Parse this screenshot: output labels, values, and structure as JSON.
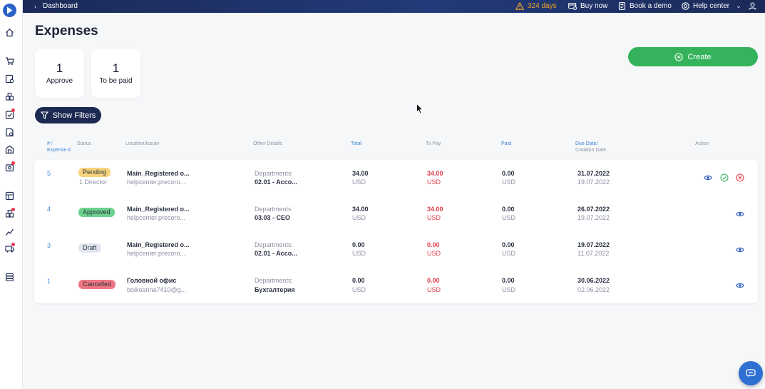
{
  "topbar": {
    "breadcrumb": "Dashboard",
    "days": "324 days",
    "buy_now": "Buy now",
    "book_demo": "Book a demo",
    "help_center": "Help center"
  },
  "page": {
    "title": "Expenses",
    "create_label": "Create",
    "filters_label": "Show Filters"
  },
  "cards": [
    {
      "count": "1",
      "label": "Approve"
    },
    {
      "count": "1",
      "label": "To be paid"
    }
  ],
  "columns": {
    "number_line1": "# /",
    "number_line2": "Expense #",
    "status": "Status",
    "location": "Location/Issuer",
    "details": "Other Details",
    "total": "Total",
    "to_pay": "To Pay",
    "paid": "Paid",
    "due_line1": "Due Date/",
    "due_line2": "Creation Date",
    "action": "Action"
  },
  "rows": [
    {
      "number": "5",
      "status": "Pending",
      "status_sub": "1 Director",
      "location": "Main_Registered o...",
      "issuer": "helpcenter.precoro...",
      "details_label": "Departments:",
      "details_value": "02.01 - Acco...",
      "total": "34.00",
      "total_cur": "USD",
      "to_pay": "34.00",
      "to_pay_cur": "USD",
      "paid": "0.00",
      "paid_cur": "USD",
      "due": "31.07.2022",
      "created": "19.07.2022"
    },
    {
      "number": "4",
      "status": "Approved",
      "status_sub": "",
      "location": "Main_Registered o...",
      "issuer": "helpcenter.precoro...",
      "details_label": "Departments:",
      "details_value": "03.03 - CEO",
      "total": "34.00",
      "total_cur": "USD",
      "to_pay": "34.00",
      "to_pay_cur": "USD",
      "paid": "0.00",
      "paid_cur": "USD",
      "due": "26.07.2022",
      "created": "19.07.2022"
    },
    {
      "number": "3",
      "status": "Draft",
      "status_sub": "",
      "location": "Main_Registered o...",
      "issuer": "helpcenter.precoro...",
      "details_label": "Departments:",
      "details_value": "02.01 - Acco...",
      "total": "0.00",
      "total_cur": "USD",
      "to_pay": "0.00",
      "to_pay_cur": "USD",
      "paid": "0.00",
      "paid_cur": "USD",
      "due": "19.07.2022",
      "created": "11.07.2022"
    },
    {
      "number": "1",
      "status": "Cancelled",
      "status_sub": "",
      "location": "Головной офис",
      "issuer": "boikoanna7410@g...",
      "details_label": "Departments:",
      "details_value": "Бухгалтерия",
      "total": "0.00",
      "total_cur": "USD",
      "to_pay": "0.00",
      "to_pay_cur": "USD",
      "paid": "0.00",
      "paid_cur": "USD",
      "due": "30.06.2022",
      "created": "02.06.2022"
    }
  ],
  "icons": {
    "view": "eye-icon",
    "approve": "check-circle-icon",
    "reject": "x-circle-icon",
    "chat": "chat-icon"
  },
  "colors": {
    "accent_blue": "#3d86d6",
    "create_green": "#35b35c",
    "navy": "#1c2a52",
    "warning": "#f2a629",
    "danger": "#e03e4a"
  }
}
